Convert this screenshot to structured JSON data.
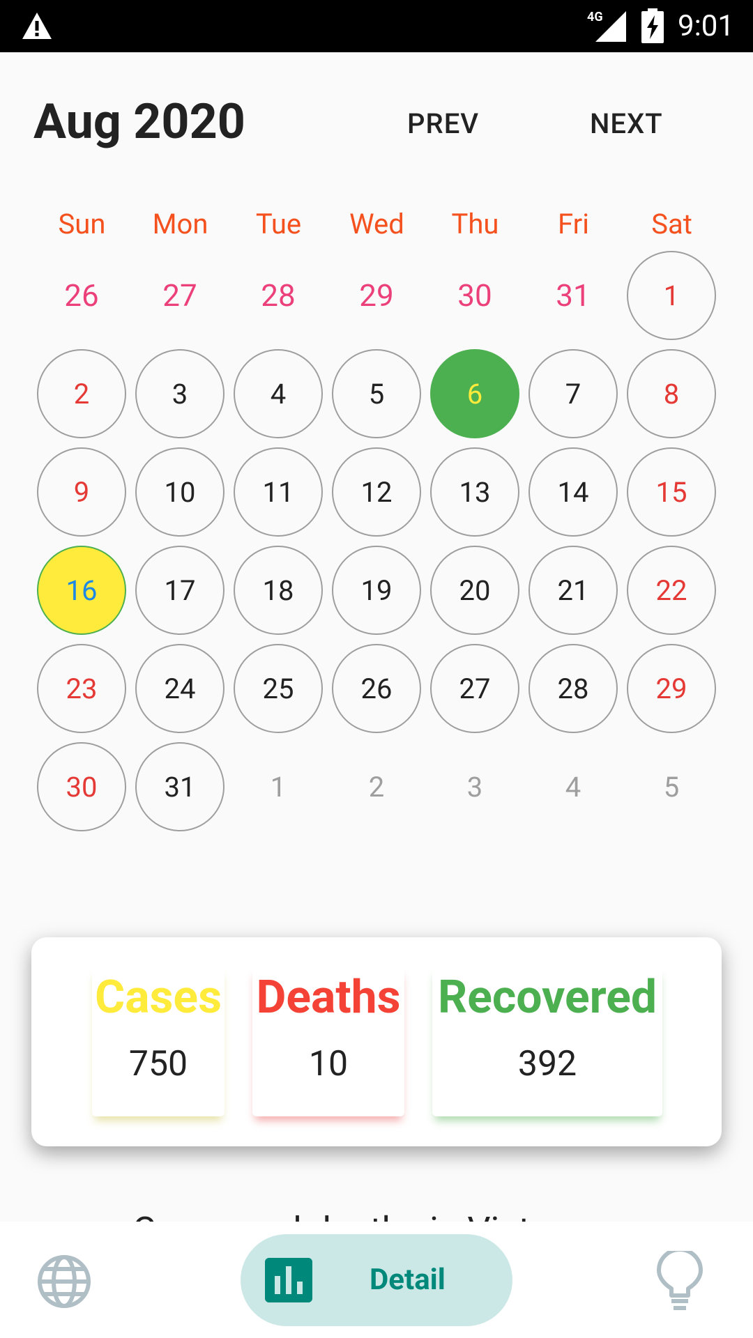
{
  "status_bar": {
    "network": "4G",
    "time": "9:01"
  },
  "calendar": {
    "month_title": "Aug 2020",
    "prev_label": "PREV",
    "next_label": "NEXT",
    "weekdays": [
      "Sun",
      "Mon",
      "Tue",
      "Wed",
      "Thu",
      "Fri",
      "Sat"
    ],
    "days": [
      {
        "label": "26",
        "type": "prev-month"
      },
      {
        "label": "27",
        "type": "prev-month"
      },
      {
        "label": "28",
        "type": "prev-month"
      },
      {
        "label": "29",
        "type": "prev-month"
      },
      {
        "label": "30",
        "type": "prev-month"
      },
      {
        "label": "31",
        "type": "prev-month"
      },
      {
        "label": "1",
        "type": "weekend"
      },
      {
        "label": "2",
        "type": "weekend"
      },
      {
        "label": "3",
        "type": "normal"
      },
      {
        "label": "4",
        "type": "normal"
      },
      {
        "label": "5",
        "type": "normal"
      },
      {
        "label": "6",
        "type": "today"
      },
      {
        "label": "7",
        "type": "normal"
      },
      {
        "label": "8",
        "type": "weekend"
      },
      {
        "label": "9",
        "type": "weekend"
      },
      {
        "label": "10",
        "type": "normal"
      },
      {
        "label": "11",
        "type": "normal"
      },
      {
        "label": "12",
        "type": "normal"
      },
      {
        "label": "13",
        "type": "normal"
      },
      {
        "label": "14",
        "type": "normal"
      },
      {
        "label": "15",
        "type": "weekend"
      },
      {
        "label": "16",
        "type": "selected"
      },
      {
        "label": "17",
        "type": "normal"
      },
      {
        "label": "18",
        "type": "normal"
      },
      {
        "label": "19",
        "type": "normal"
      },
      {
        "label": "20",
        "type": "normal"
      },
      {
        "label": "21",
        "type": "normal"
      },
      {
        "label": "22",
        "type": "weekend"
      },
      {
        "label": "23",
        "type": "weekend"
      },
      {
        "label": "24",
        "type": "normal"
      },
      {
        "label": "25",
        "type": "normal"
      },
      {
        "label": "26",
        "type": "normal"
      },
      {
        "label": "27",
        "type": "normal"
      },
      {
        "label": "28",
        "type": "normal"
      },
      {
        "label": "29",
        "type": "weekend"
      },
      {
        "label": "30",
        "type": "weekend"
      },
      {
        "label": "31",
        "type": "normal"
      },
      {
        "label": "1",
        "type": "next-month"
      },
      {
        "label": "2",
        "type": "next-month"
      },
      {
        "label": "3",
        "type": "next-month"
      },
      {
        "label": "4",
        "type": "next-month"
      },
      {
        "label": "5",
        "type": "next-month"
      }
    ]
  },
  "stats": {
    "cases_label": "Cases",
    "cases_value": "750",
    "deaths_label": "Deaths",
    "deaths_value": "10",
    "recovered_label": "Recovered",
    "recovered_value": "392"
  },
  "section_title": "Cases and deaths in Viet",
  "bottom_nav": {
    "detail_label": "Detail"
  },
  "colors": {
    "accent": "#00897b",
    "weekday_header": "#f4511e",
    "today": "#4caf50",
    "selected": "#ffeb3b",
    "cases": "#ffeb3b",
    "deaths": "#f44336",
    "recovered": "#4caf50"
  },
  "icons": [
    "warning-icon",
    "signal-icon",
    "battery-charging-icon",
    "globe-icon",
    "bar-chart-icon",
    "lightbulb-icon"
  ]
}
